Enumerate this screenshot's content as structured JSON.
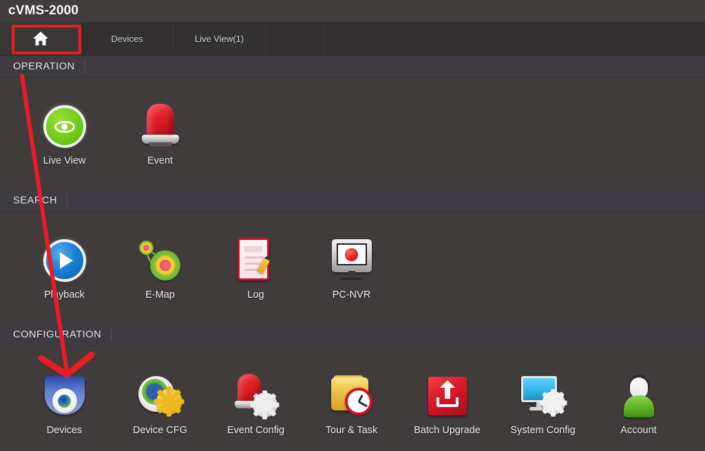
{
  "app": {
    "title": "cVMS-2000"
  },
  "tabs": [
    {
      "label": "",
      "icon": "home-icon",
      "active": true
    },
    {
      "label": "Devices",
      "icon": "",
      "active": false
    },
    {
      "label": "Live View(1)",
      "icon": "",
      "active": false
    }
  ],
  "sections": [
    {
      "title": "OPERATION",
      "items": [
        {
          "label": "Live View",
          "icon": "live-view-icon"
        },
        {
          "label": "Event",
          "icon": "event-beacon-icon"
        }
      ]
    },
    {
      "title": "SEARCH",
      "items": [
        {
          "label": "Playback",
          "icon": "playback-icon"
        },
        {
          "label": "E-Map",
          "icon": "emap-icon"
        },
        {
          "label": "Log",
          "icon": "log-icon"
        },
        {
          "label": "PC-NVR",
          "icon": "pc-nvr-icon"
        }
      ]
    },
    {
      "title": "CONFIGURATION",
      "items": [
        {
          "label": "Devices",
          "icon": "devices-icon"
        },
        {
          "label": "Device CFG",
          "icon": "device-cfg-icon"
        },
        {
          "label": "Event Config",
          "icon": "event-config-icon"
        },
        {
          "label": "Tour & Task",
          "icon": "tour-task-icon"
        },
        {
          "label": "Batch Upgrade",
          "icon": "batch-upgrade-icon"
        },
        {
          "label": "System Config",
          "icon": "system-config-icon"
        },
        {
          "label": "Account",
          "icon": "account-icon"
        }
      ]
    }
  ],
  "annotation": {
    "color": "#ec1c24",
    "highlight_target": "home-tab",
    "arrow_target": "Devices"
  },
  "colors": {
    "titlebar_bg": "#413d3d",
    "tabbar_bg": "#323030",
    "body_bg": "#403c3c",
    "section_band_bg": "#3e3c42",
    "accent_red": "#ec1c24"
  }
}
